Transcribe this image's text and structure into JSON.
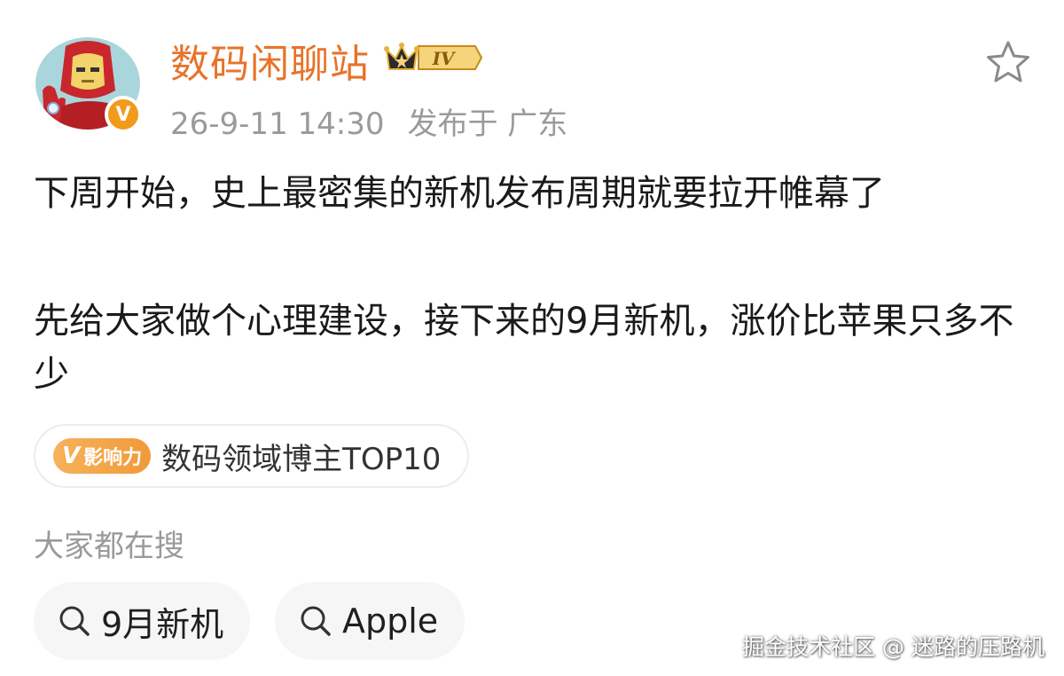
{
  "post": {
    "username": "数码闲聊站",
    "rank_level": "IV",
    "timestamp": "26-9-11 14:30",
    "location": "发布于 广东",
    "paragraphs": [
      "下周开始，史上最密集的新机发布周期就要拉开帷幕了",
      "先给大家做个心理建设，接下来的9月新机，涨价比苹果只多不少"
    ],
    "influence_tag": "影响力",
    "influence_tag_v": "V",
    "influence_text": "数码领域博主TOP10"
  },
  "search": {
    "heading": "大家都在搜",
    "chips": [
      "9月新机",
      "Apple"
    ]
  },
  "watermark": "掘金技术社区 @ 迷路的压路机",
  "colors": {
    "username": "#e8732a",
    "meta": "#9a9a9a",
    "influence": "#f09a3a",
    "chip_bg": "#f6f6f6"
  }
}
